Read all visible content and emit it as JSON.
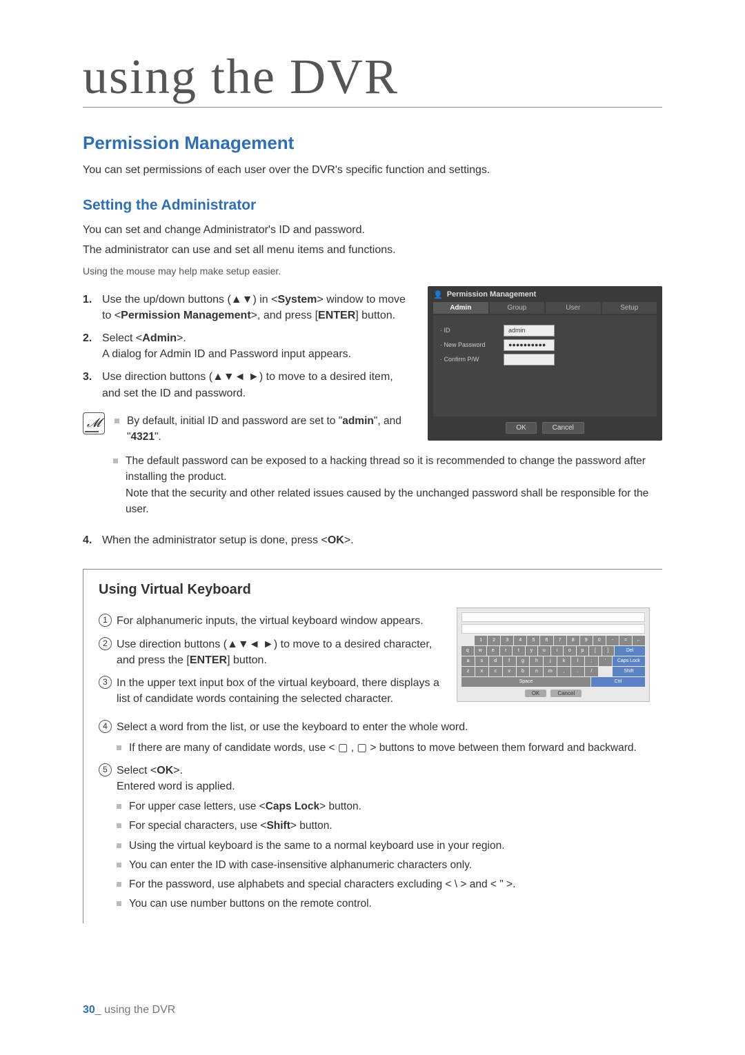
{
  "chapter_title": "using the DVR",
  "section_title": "Permission Management",
  "section_intro": "You can set permissions of each user over the DVR's specific function and settings.",
  "subsection_title": "Setting the Administrator",
  "subsection_intro1": "You can set and change Administrator's ID and password.",
  "subsection_intro2": "The administrator can use and set all menu items and functions.",
  "mouse_note": "Using the mouse may help make setup easier.",
  "steps": {
    "s1a": "Use the up/down buttons (▲▼) in <",
    "s1b": "System",
    "s1c": "> window to move to <",
    "s1d": "Permission Management",
    "s1e": ">, and press [",
    "s1f": "ENTER",
    "s1g": "] button.",
    "s2a": "Select <",
    "s2b": "Admin",
    "s2c": ">.",
    "s2d": "A dialog for Admin ID and Password input appears.",
    "s3": "Use direction buttons (▲▼◄ ►) to move to a desired item, and set the ID and password.",
    "s4a": "When the administrator setup is done, press <",
    "s4b": "OK",
    "s4c": ">."
  },
  "notes1": {
    "n1a": "By default, initial ID and password are set to \"",
    "n1b": "admin",
    "n1c": "\", and \"",
    "n1d": "4321",
    "n1e": "\".",
    "n2": "The default password can be exposed to a hacking thread so it is recommended to change the password after installing the product.",
    "n2b": "Note that the security and other related issues caused by the unchanged password shall be responsible for the user."
  },
  "dialog": {
    "title": "Permission Management",
    "tabs": {
      "t1": "Admin",
      "t2": "Group",
      "t3": "User",
      "t4": "Setup"
    },
    "fields": {
      "id_label": "· ID",
      "id_value": "admin",
      "newpw_label": "· New Password",
      "newpw_value": "●●●●●●●●●●",
      "conf_label": "· Confirm P/W",
      "conf_value": ""
    },
    "ok": "OK",
    "cancel": "Cancel"
  },
  "vk": {
    "heading": "Using Virtual Keyboard",
    "i1": "For alphanumeric inputs, the virtual keyboard window appears.",
    "i2a": "Use direction buttons (▲▼◄ ►) to move to a desired character, and press the [",
    "i2b": "ENTER",
    "i2c": "] button.",
    "i3": "In the upper text input box of the virtual keyboard, there displays a list of candidate words containing the selected character.",
    "i4": "Select a word from the list, or use the keyboard to enter the whole word.",
    "i4sub": "If there are many of candidate words, use < ▢ , ▢ > buttons to move between them forward and backward.",
    "i5a": "Select <",
    "i5b": "OK",
    "i5c": ">.",
    "i5d": "Entered word is applied.",
    "sub1a": "For upper case letters, use <",
    "sub1b": "Caps Lock",
    "sub1c": "> button.",
    "sub2a": "For special characters, use <",
    "sub2b": "Shift",
    "sub2c": "> button.",
    "sub3": "Using the virtual keyboard is the same to a normal keyboard use in your region.",
    "sub4": "You can enter the ID with case-insensitive alphanumeric characters only.",
    "sub5": "For the password, use alphabets and special characters excluding < \\ > and < \" >.",
    "sub6": "You can use number buttons on the remote control."
  },
  "vk_mock": {
    "row1": [
      "1",
      "2",
      "3",
      "4",
      "5",
      "6",
      "7",
      "8",
      "9",
      "0",
      "-",
      "=",
      "←"
    ],
    "row2": [
      "q",
      "w",
      "e",
      "r",
      "t",
      "y",
      "u",
      "i",
      "o",
      "p",
      "[",
      "]"
    ],
    "row2_del": "Del",
    "row3": [
      "a",
      "s",
      "d",
      "f",
      "g",
      "h",
      "j",
      "k",
      "l",
      ";",
      "'"
    ],
    "row3_caps": "Caps Lock",
    "row4": [
      "z",
      "x",
      "c",
      "v",
      "b",
      "n",
      "m",
      ",",
      ".",
      "/"
    ],
    "row4_shift": "Shift",
    "space": "Space",
    "ctrl": "Ctrl",
    "ok": "OK",
    "cancel": "Cancel"
  },
  "footer": {
    "page": "30",
    "sep": "_",
    "text": " using the DVR"
  }
}
